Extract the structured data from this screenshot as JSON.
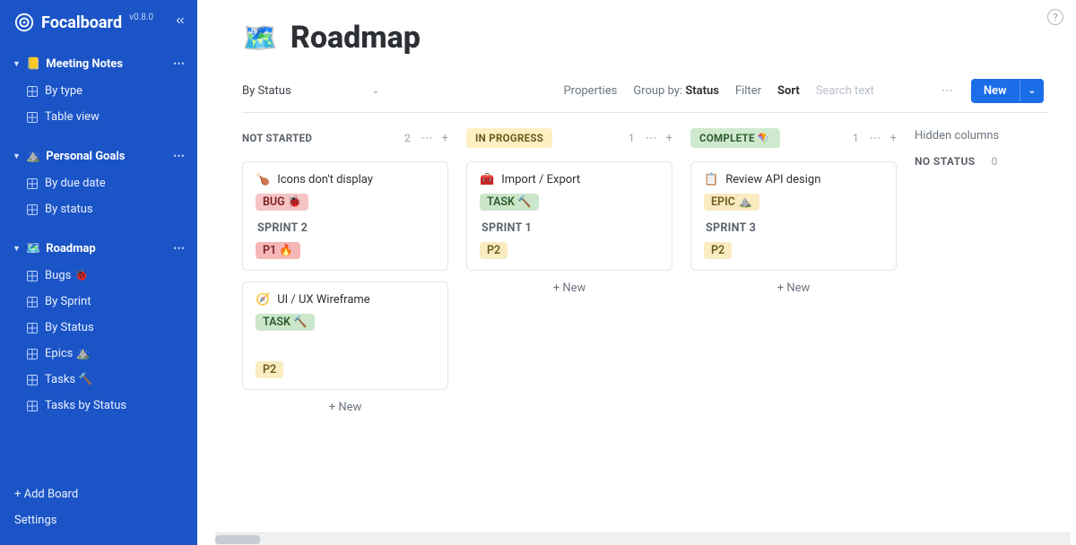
{
  "app": {
    "name": "Focalboard",
    "version": "v0.8.0"
  },
  "sidebar": {
    "groups": [
      {
        "title": "Meeting Notes",
        "emoji": "📒",
        "items": [
          {
            "label": "By type"
          },
          {
            "label": "Table view"
          }
        ]
      },
      {
        "title": "Personal Goals",
        "emoji": "⛰️",
        "items": [
          {
            "label": "By due date"
          },
          {
            "label": "By status"
          }
        ]
      },
      {
        "title": "Roadmap",
        "emoji": "🗺️",
        "items": [
          {
            "label": "Bugs 🐞"
          },
          {
            "label": "By Sprint"
          },
          {
            "label": "By Status"
          },
          {
            "label": "Epics ⛰️"
          },
          {
            "label": "Tasks 🔨"
          },
          {
            "label": "Tasks by Status"
          }
        ]
      }
    ],
    "add_board": "+ Add Board",
    "settings": "Settings"
  },
  "page": {
    "emoji": "🗺️",
    "title": "Roadmap"
  },
  "toolbar": {
    "view": "By Status",
    "properties": "Properties",
    "group_by_label": "Group by:",
    "group_by_value": "Status",
    "filter": "Filter",
    "sort": "Sort",
    "search_placeholder": "Search text",
    "new_label": "New"
  },
  "board": {
    "columns": [
      {
        "title": "NOT STARTED",
        "style": "plain",
        "count": "2",
        "cards": [
          {
            "emoji": "🍗",
            "title": "Icons don't display",
            "tag": {
              "text": "BUG 🐞",
              "style": "red"
            },
            "sprint": "SPRINT 2",
            "priority": {
              "text": "P1 🔥",
              "style": "p1"
            }
          },
          {
            "emoji": "🧭",
            "title": "UI / UX Wireframe",
            "tag": {
              "text": "TASK 🔨",
              "style": "green"
            },
            "sprint": "",
            "priority": {
              "text": "P2",
              "style": "p2"
            }
          }
        ],
        "add_label": "+ New"
      },
      {
        "title": "IN PROGRESS",
        "style": "yellow",
        "count": "1",
        "cards": [
          {
            "emoji": "🧰",
            "title": "Import / Export",
            "tag": {
              "text": "TASK 🔨",
              "style": "green"
            },
            "sprint": "SPRINT 1",
            "priority": {
              "text": "P2",
              "style": "p2"
            }
          }
        ],
        "add_label": "+ New"
      },
      {
        "title": "COMPLETE 🪁",
        "style": "green",
        "count": "1",
        "cards": [
          {
            "emoji": "📋",
            "title": "Review API design",
            "tag": {
              "text": "EPIC ⛰️",
              "style": "yellow"
            },
            "sprint": "SPRINT 3",
            "priority": {
              "text": "P2",
              "style": "p2"
            }
          }
        ],
        "add_label": "+ New"
      }
    ],
    "hidden_columns_label": "Hidden columns",
    "no_status": {
      "label": "NO STATUS",
      "count": "0"
    }
  }
}
